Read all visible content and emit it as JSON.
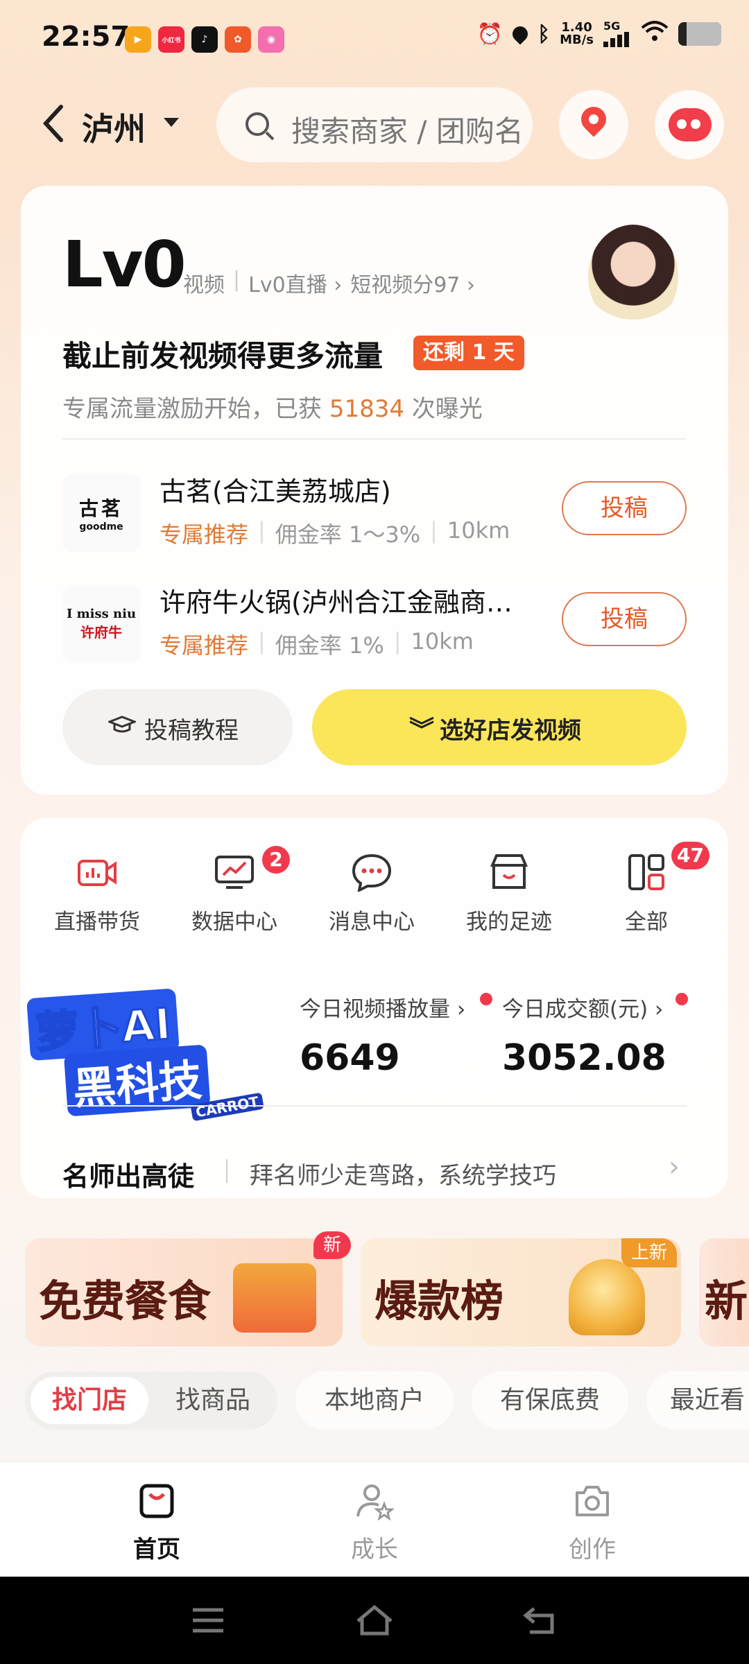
{
  "status_bar": {
    "time": "22:57",
    "apps": [
      {
        "name": "video-app-icon",
        "label": "",
        "color": "#f7a61c"
      },
      {
        "name": "xiaohongshu-app-icon",
        "label": "小红书",
        "color": "#ef2741"
      },
      {
        "name": "tiktok-app-icon",
        "label": "",
        "color": "#111111"
      },
      {
        "name": "pinduoduo-app-icon",
        "label": "",
        "color": "#f05a2a"
      },
      {
        "name": "camera-app-icon",
        "label": "",
        "color": "#f36fb0"
      }
    ],
    "net_speed_value": "1.40",
    "net_speed_unit": "MB/s",
    "network_type": "5G",
    "battery_level": 0.2
  },
  "header": {
    "city": "泸州",
    "search_placeholder": "搜索商家 / 团购名"
  },
  "level_card": {
    "level": "Lv0",
    "links": [
      "视频",
      "Lv0直播",
      "短视频分97"
    ],
    "headline": "截止前发视频得更多流量",
    "remaining_badge": "还剩 1 天",
    "sub_prefix": "专属流量激励开始，已获",
    "sub_count": "51834",
    "sub_suffix": "次曝光",
    "stores": [
      {
        "logo_line1": "古茗",
        "logo_line2": "goodme",
        "name": "古茗(合江美荔城店)",
        "tag": "专属推荐",
        "commission": "佣金率 1～3%",
        "distance": "10km",
        "button": "投稿"
      },
      {
        "logo_line1": "I miss niu",
        "logo_line2": "许府牛",
        "name": "许府牛火锅(泸州合江金融商…",
        "tag": "专属推荐",
        "commission": "佣金率 1%",
        "distance": "10km",
        "button": "投稿"
      }
    ],
    "tutorial_button": "投稿教程",
    "primary_button": "选好店发视频"
  },
  "quick_actions": [
    {
      "label": "直播带货",
      "icon": "live-camera-icon",
      "badge": ""
    },
    {
      "label": "数据中心",
      "icon": "data-monitor-icon",
      "badge": "2"
    },
    {
      "label": "消息中心",
      "icon": "message-bubble-icon",
      "badge": ""
    },
    {
      "label": "我的足迹",
      "icon": "shop-icon",
      "badge": ""
    },
    {
      "label": "全部",
      "icon": "all-grid-icon",
      "badge": "47"
    }
  ],
  "promo": {
    "line1": "萝卜AI",
    "line2": "黑科技",
    "tag": "CARROT"
  },
  "stats": {
    "views_label": "今日视频播放量",
    "views_value": "6649",
    "gmv_label": "今日成交额(元)",
    "gmv_value": "3052.08"
  },
  "mentor": {
    "title": "名师出高徒",
    "desc": "拜名师少走弯路，系统学技巧"
  },
  "banners": [
    {
      "text": "免费餐食",
      "tag": "新"
    },
    {
      "text": "爆款榜",
      "tag": "上新"
    },
    {
      "text": "新",
      "tag": ""
    }
  ],
  "filter_tabs": [
    "找门店",
    "找商品",
    "本地商户",
    "有保底费",
    "最近看"
  ],
  "bottom_nav": [
    {
      "label": "首页",
      "icon": "home-bag-icon",
      "active": true
    },
    {
      "label": "成长",
      "icon": "growth-user-star-icon",
      "active": false
    },
    {
      "label": "创作",
      "icon": "camera-create-icon",
      "active": false
    }
  ]
}
